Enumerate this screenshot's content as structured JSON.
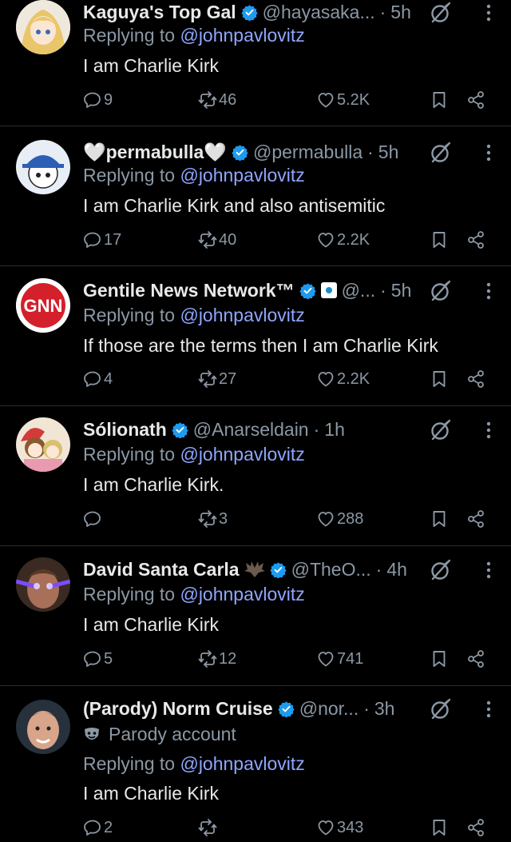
{
  "tweets": [
    {
      "display_name": "Kaguya's Top Gal",
      "handle": "@hayasaka...",
      "time": "5h",
      "replying_prefix": "Replying to ",
      "replying_to": "@johnpavlovitz",
      "text": "I am Charlie Kirk",
      "replies": "9",
      "retweets": "46",
      "likes": "5.2K",
      "avatar": "anime-girl-avatar"
    },
    {
      "display_name": "🤍permabulla🤍",
      "handle": "@permabulla",
      "time": "5h",
      "replying_prefix": "Replying to ",
      "replying_to": "@johnpavlovitz",
      "text": "I am Charlie Kirk and also antisemitic",
      "replies": "17",
      "retweets": "40",
      "likes": "2.2K",
      "avatar": "cartoon-cap-avatar"
    },
    {
      "display_name": "Gentile News Network™",
      "handle": "@...",
      "time": "5h",
      "replying_prefix": "Replying to ",
      "replying_to": "@johnpavlovitz",
      "text": "If those are the terms then I am Charlie Kirk",
      "replies": "4",
      "retweets": "27",
      "likes": "2.2K",
      "avatar": "gnn-logo-avatar",
      "avatar_text": "GNN"
    },
    {
      "display_name": "Sólionath",
      "handle": "@Anarseldain",
      "time": "1h",
      "replying_prefix": "Replying to ",
      "replying_to": "@johnpavlovitz",
      "text": "I am Charlie Kirk.",
      "replies": "",
      "retweets": "3",
      "likes": "288",
      "avatar": "anime-duo-avatar"
    },
    {
      "display_name": "David Santa Carla",
      "handle": "@TheO...",
      "time": "4h",
      "replying_prefix": "Replying to ",
      "replying_to": "@johnpavlovitz",
      "text": "I am Charlie Kirk",
      "replies": "5",
      "retweets": "12",
      "likes": "741",
      "avatar": "laser-eyes-avatar"
    },
    {
      "display_name": "(Parody) Norm Cruise",
      "handle": "@nor...",
      "time": "3h",
      "parody_label": "Parody account",
      "replying_prefix": "Replying to ",
      "replying_to": "@johnpavlovitz",
      "text": "I am Charlie Kirk",
      "replies": "2",
      "retweets": "",
      "likes": "343",
      "avatar": "man-portrait-avatar"
    }
  ],
  "colors": {
    "background": "#000000",
    "text": "#e7e9ea",
    "secondary": "#8b98a5",
    "mention": "#8fa6ff",
    "verified": "#1d9bf0",
    "divider": "#2a2d31"
  }
}
